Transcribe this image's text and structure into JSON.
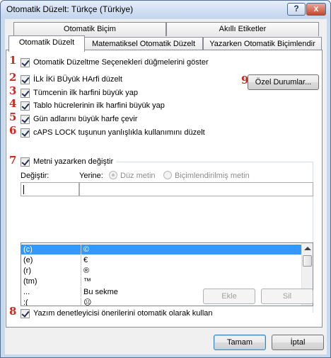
{
  "window": {
    "title": "Otomatik Düzelt: Türkçe (Türkiye)",
    "help_label": "?",
    "close_label": "x"
  },
  "tabs": {
    "top": [
      "Otomatik Biçim",
      "Akıllı Etiketler"
    ],
    "bottom": [
      "Otomatik Düzelt",
      "Matematiksel Otomatik Düzelt",
      "Yazarken Otomatik Biçimlendir"
    ]
  },
  "markers": [
    "1",
    "2",
    "3",
    "4",
    "5",
    "6",
    "7",
    "8",
    "9"
  ],
  "options": {
    "show_buttons": "Otomatik Düzeltme Seçenekleri düğmelerini göster",
    "two_initials": "İLk İKi BÜyük HArfi düzelt",
    "first_letter_sentence": "Tümcenin ilk harfini büyük yap",
    "first_letter_table": "Tablo hücrelerinin ilk harfini büyük yap",
    "day_names": "Gün adlarını büyük harfe çevir",
    "caps_lock": "cAPS LOCK tuşunun yanlışlıkla kullanımını düzelt",
    "replace_text": "Metni yazarken değiştir",
    "spell_suggestions": "Yazım denetleyicisi önerilerini otomatik olarak kullan"
  },
  "exceptions_button": "Özel Durumlar...",
  "replace": {
    "replace_label": "Değiştir:",
    "with_label": "Yerine:",
    "plain_text": "Düz metin",
    "formatted_text": "Biçimlendirilmiş metin",
    "replace_value": "",
    "with_value": ""
  },
  "list": [
    {
      "from": "(c)",
      "to": "©"
    },
    {
      "from": "(e)",
      "to": "€"
    },
    {
      "from": "(r)",
      "to": "®"
    },
    {
      "from": "(tm)",
      "to": "™"
    },
    {
      "from": "...",
      "to": "Bu sekme"
    },
    {
      "from": ":(",
      "to": "☹"
    }
  ],
  "buttons": {
    "add": "Ekle",
    "delete": "Sil",
    "ok": "Tamam",
    "cancel": "İptal"
  },
  "colors": {
    "marker": "#d3261d",
    "selection": "#3399ff"
  }
}
